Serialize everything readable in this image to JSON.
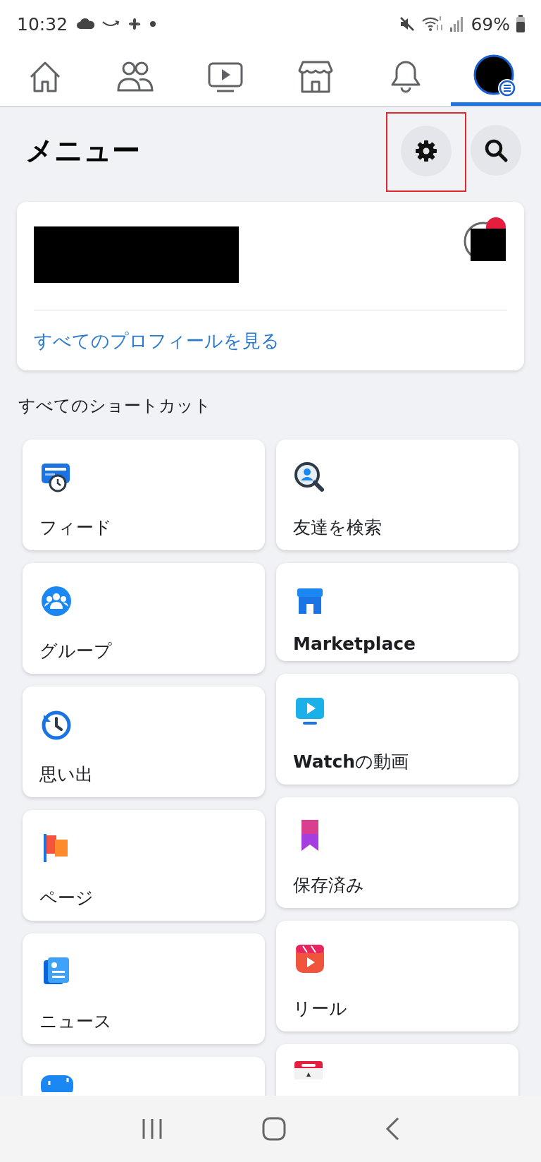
{
  "status_bar": {
    "time": "10:32",
    "battery": "69%"
  },
  "nav_tabs": [
    {
      "selected": false
    },
    {
      "selected": false
    },
    {
      "selected": false
    },
    {
      "selected": false
    },
    {
      "selected": false
    },
    {
      "selected": true
    }
  ],
  "header": {
    "title": "メニュー"
  },
  "profile_card": {
    "link": "すべてのプロフィールを見る"
  },
  "shortcuts_heading": "すべてのショートカット",
  "shortcut_columns": [
    [
      {
        "label": "フィード",
        "bold": false
      },
      {
        "label": "グループ",
        "bold": false
      },
      {
        "label": "思い出",
        "bold": false
      },
      {
        "label": "ページ",
        "bold": false
      },
      {
        "label": "ニュース",
        "bold": false
      }
    ],
    [
      {
        "label": "友達を検索",
        "bold": false
      },
      {
        "label": "Marketplace",
        "bold": true
      },
      {
        "label": "**Watch**の動画",
        "bold": false
      },
      {
        "label": "保存済み",
        "bold": false
      },
      {
        "label": "リール",
        "bold": false
      }
    ]
  ]
}
